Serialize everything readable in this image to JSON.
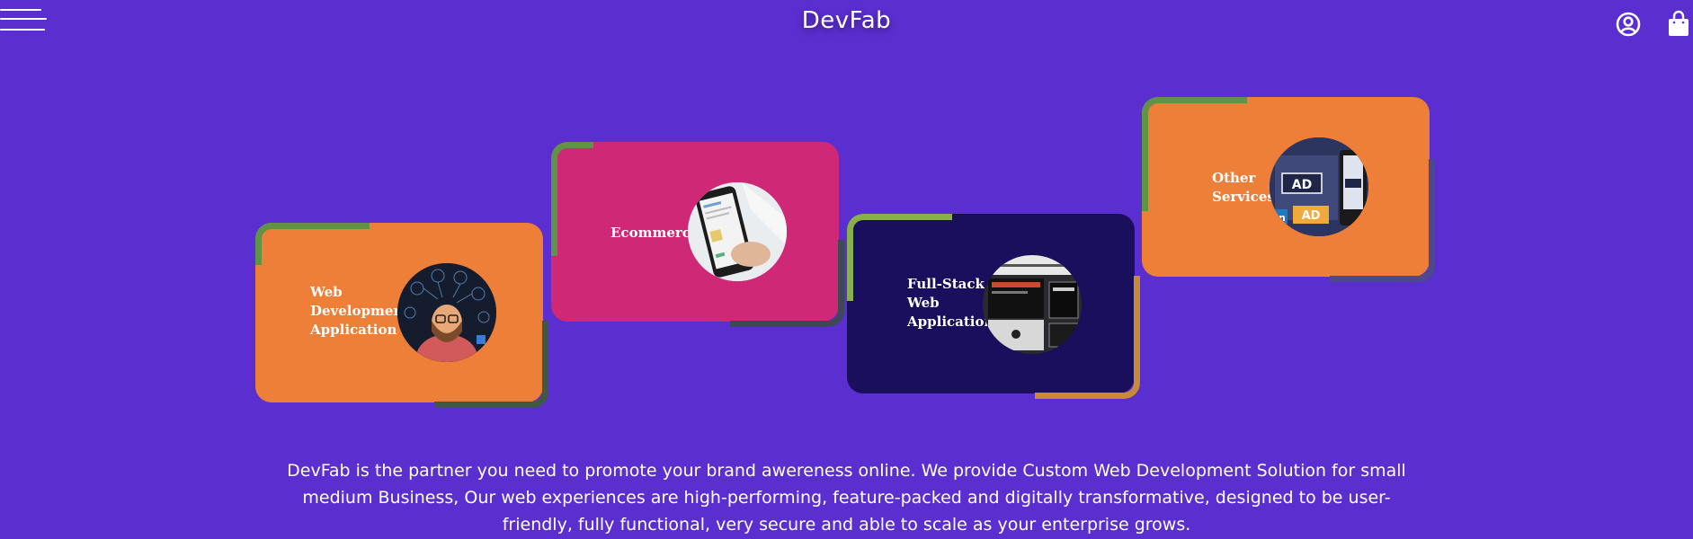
{
  "header": {
    "brand": "DevFab"
  },
  "icons": {
    "menu": "hamburger-menu-icon",
    "user": "user-circle-icon",
    "bag": "shopping-bag-icon"
  },
  "cards": [
    {
      "title": "Web\nDevelopment\nApplication",
      "color": "#ee7f38"
    },
    {
      "title": "Ecommerce",
      "color": "#cf2876"
    },
    {
      "title": "Full-Stack\nWeb\nApplication",
      "color": "#1a0f5c"
    },
    {
      "title": "Other\nServices",
      "color": "#ee7f38"
    }
  ],
  "description": "DevFab is the partner you need to promote your brand awereness online. We provide Custom Web Development Solution for small medium Business, Our web experiences are high-performing, feature-packed and digitally transformative, designed to be user-friendly, fully functional, very secure and able to scale as your enterprise grows.",
  "colors": {
    "background": "#5b2ed0",
    "accent_green": "#5f9447",
    "accent_dark": "#3d4a55",
    "accent_gold": "#c88a35"
  }
}
